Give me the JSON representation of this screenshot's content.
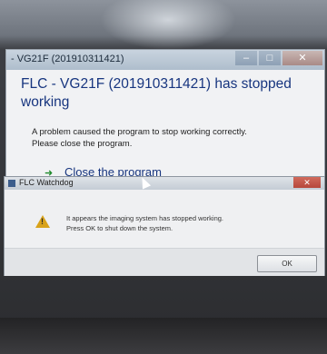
{
  "error_dialog": {
    "title": "- VG21F (201910311421)",
    "heading": "FLC - VG21F (201910311421) has stopped working",
    "message_line1": "A problem caused the program to stop working correctly.",
    "message_line2": "Please close the program.",
    "close_program_label": "Close the program",
    "close_program_icon": "green-arrow-icon"
  },
  "watchdog_dialog": {
    "title": "FLC Watchdog",
    "message_line1": "It appears the imaging system has stopped working.",
    "message_line2": "Press OK to shut down the system.",
    "ok_label": "OK",
    "warning_icon": "warning-icon"
  },
  "colors": {
    "heading_blue": "#17357f",
    "warning_yellow": "#d8a21a",
    "close_red": "#b7473b"
  }
}
